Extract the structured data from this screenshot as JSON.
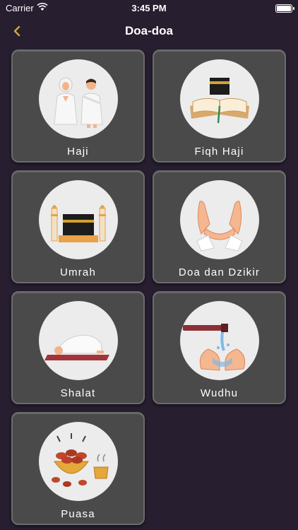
{
  "status_bar": {
    "carrier": "Carrier",
    "time": "3:45 PM"
  },
  "nav": {
    "title": "Doa-doa",
    "back_icon": "chevron-left-icon",
    "accent": "#d9a441"
  },
  "colors": {
    "background": "#271e30",
    "card": "#4a4a4a",
    "card_border": "#6b6b6b",
    "circle": "#ececec"
  },
  "categories": [
    {
      "label": "Haji",
      "icon": "pilgrims-icon"
    },
    {
      "label": "Fiqh Haji",
      "icon": "book-kaaba-icon"
    },
    {
      "label": "Umrah",
      "icon": "kaaba-mosque-icon"
    },
    {
      "label": "Doa dan Dzikir",
      "icon": "praying-hands-icon"
    },
    {
      "label": "Shalat",
      "icon": "prostration-icon"
    },
    {
      "label": "Wudhu",
      "icon": "ablution-icon"
    },
    {
      "label": "Puasa",
      "icon": "dates-tea-icon"
    }
  ]
}
